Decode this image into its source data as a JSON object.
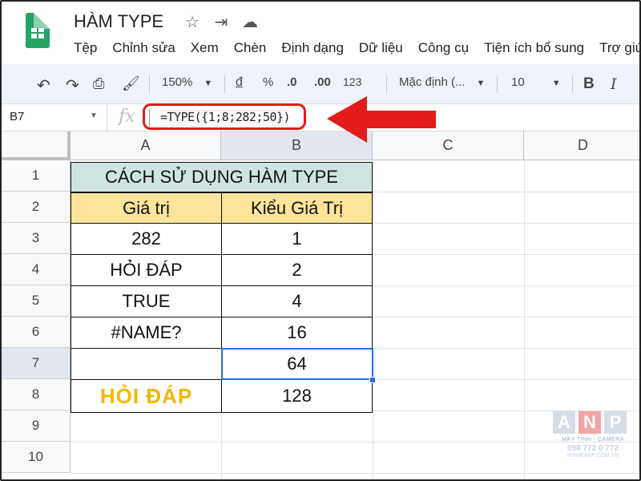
{
  "header": {
    "title": "HÀM TYPE",
    "menu": [
      "Tệp",
      "Chỉnh sửa",
      "Xem",
      "Chèn",
      "Định dạng",
      "Dữ liệu",
      "Công cụ",
      "Tiện ích bổ sung",
      "Trợ giú"
    ]
  },
  "toolbar": {
    "zoom": "150%",
    "currency": "đ",
    "percent": "%",
    "decrease_decimal": ".0",
    "increase_decimal": ".00",
    "number_format": "123",
    "font": "Mặc định (...",
    "font_size": "10",
    "bold": "B",
    "italic": "I"
  },
  "formula_bar": {
    "cell_ref": "B7",
    "fx": "fx",
    "formula": "=TYPE({1;8;282;50})"
  },
  "columns": [
    "A",
    "B",
    "C",
    "D"
  ],
  "rows": [
    "1",
    "2",
    "3",
    "4",
    "5",
    "6",
    "7",
    "8",
    "9",
    "10"
  ],
  "sheet": {
    "title": "CÁCH SỬ DỤNG HÀM TYPE",
    "col_a_header": "Giá trị",
    "col_b_header": "Kiểu Giá Trị",
    "data": [
      {
        "a": "282",
        "b": "1"
      },
      {
        "a": "HỎI ĐÁP",
        "b": "2"
      },
      {
        "a": "TRUE",
        "b": "4"
      },
      {
        "a": "#NAME?",
        "b": "16"
      },
      {
        "a": "",
        "b": "64"
      },
      {
        "a": "HỎI ĐÁP",
        "b": "128"
      }
    ]
  },
  "watermark": {
    "letters": [
      "A",
      "N",
      "P"
    ],
    "tagline": "MÁY TÍNH - CAMERA",
    "phone": "098 772 0 772",
    "website": "WWW.ANP.COM.VN"
  },
  "colors": {
    "title_fill": "#d0e3e3",
    "header_fill": "#fde49a",
    "selection": "#1a73e8",
    "callout": "#e21b1b",
    "sheets_green": "#23a566"
  }
}
